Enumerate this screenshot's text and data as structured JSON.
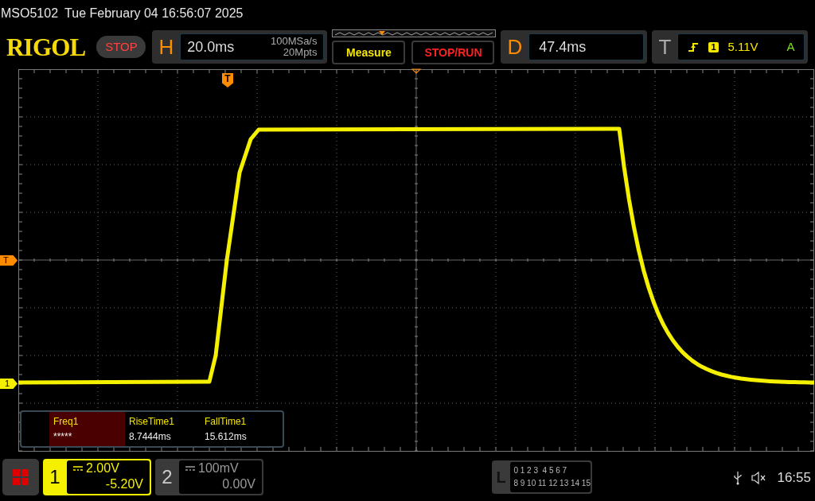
{
  "header": {
    "model": "MSO5102",
    "datetime": "Tue February 04 16:56:07 2025"
  },
  "logo": "RIGOL",
  "run_state": "STOP",
  "horizontal": {
    "label": "H",
    "timebase": "20.0ms",
    "sample_rate": "100MSa/s",
    "memory_depth": "20Mpts"
  },
  "buttons": [
    "Measure",
    "STOP/RUN"
  ],
  "delay": {
    "label": "D",
    "value": "47.4ms"
  },
  "trigger": {
    "label": "T",
    "channel": "1",
    "level": "5.11V",
    "mode": "A"
  },
  "markers": {
    "trigger_top": "T",
    "trigger_level": "T",
    "channel": "1"
  },
  "measurements": [
    {
      "name": "Freq1",
      "value": "*****",
      "selected": true
    },
    {
      "name": "RiseTime1",
      "value": "8.7444ms",
      "selected": false
    },
    {
      "name": "FallTime1",
      "value": "15.612ms",
      "selected": false
    }
  ],
  "channels": [
    {
      "number": "1",
      "scale": "2.00V",
      "offset": "-5.20V",
      "on": true
    },
    {
      "number": "2",
      "scale": "100mV",
      "offset": "0.00V",
      "on": false
    }
  ],
  "logic": {
    "label": "L",
    "rows": [
      "0 1 2 3  4 5 6 7",
      "8 9 10 11 12 13 14 15"
    ]
  },
  "clock": "16:55"
}
